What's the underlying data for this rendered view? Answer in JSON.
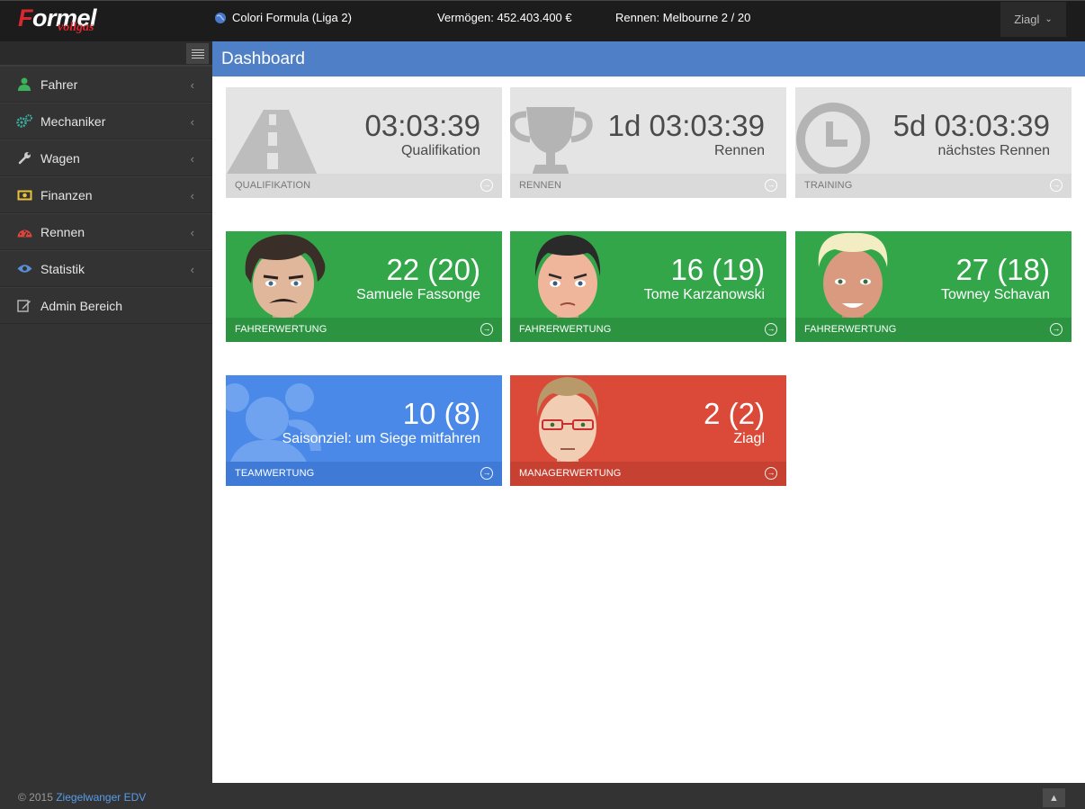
{
  "header": {
    "logo_main_first": "F",
    "logo_main_rest": "ormel",
    "logo_sub": "vollgas",
    "league": "Colori Formula (Liga 2)",
    "money": "Vermögen: 452.403.400 €",
    "race": "Rennen: Melbourne 2 / 20",
    "user": "Ziagl"
  },
  "sidebar": {
    "items": [
      {
        "label": "Fahrer",
        "icon": "user-icon",
        "color": "#3cb05a"
      },
      {
        "label": "Mechaniker",
        "icon": "gears-icon",
        "color": "#3cb0a0"
      },
      {
        "label": "Wagen",
        "icon": "wrench-icon",
        "color": "#cccccc"
      },
      {
        "label": "Finanzen",
        "icon": "money-icon",
        "color": "#e8c23a"
      },
      {
        "label": "Rennen",
        "icon": "speedometer-icon",
        "color": "#d9453a"
      },
      {
        "label": "Statistik",
        "icon": "eye-icon",
        "color": "#5a8fd8"
      },
      {
        "label": "Admin Bereich",
        "icon": "edit-icon",
        "color": "#bbbbbb"
      }
    ]
  },
  "content": {
    "title": "Dashboard",
    "tiles": [
      {
        "value": "03:03:39",
        "sub": "Qualifikation",
        "footer": "QUALIFIKATION",
        "color": "grey"
      },
      {
        "value": "1d 03:03:39",
        "sub": "Rennen",
        "footer": "RENNEN",
        "color": "grey"
      },
      {
        "value": "5d 03:03:39",
        "sub": "nächstes Rennen",
        "footer": "TRAINING",
        "color": "grey"
      },
      {
        "value": "22 (20)",
        "sub": "Samuele Fassonge",
        "footer": "FAHRERWERTUNG",
        "color": "green"
      },
      {
        "value": "16 (19)",
        "sub": "Tome Karzanowski",
        "footer": "FAHRERWERTUNG",
        "color": "green"
      },
      {
        "value": "27 (18)",
        "sub": "Towney Schavan",
        "footer": "FAHRERWERTUNG",
        "color": "green"
      },
      {
        "value": "10 (8)",
        "sub": "Saisonziel: um Siege mitfahren",
        "footer": "TEAMWERTUNG",
        "color": "blue"
      },
      {
        "value": "2 (2)",
        "sub": "Ziagl",
        "footer": "MANAGERWERTUNG",
        "color": "red"
      }
    ]
  },
  "footer": {
    "copy": "© 2015",
    "link": "Ziegelwanger EDV"
  }
}
